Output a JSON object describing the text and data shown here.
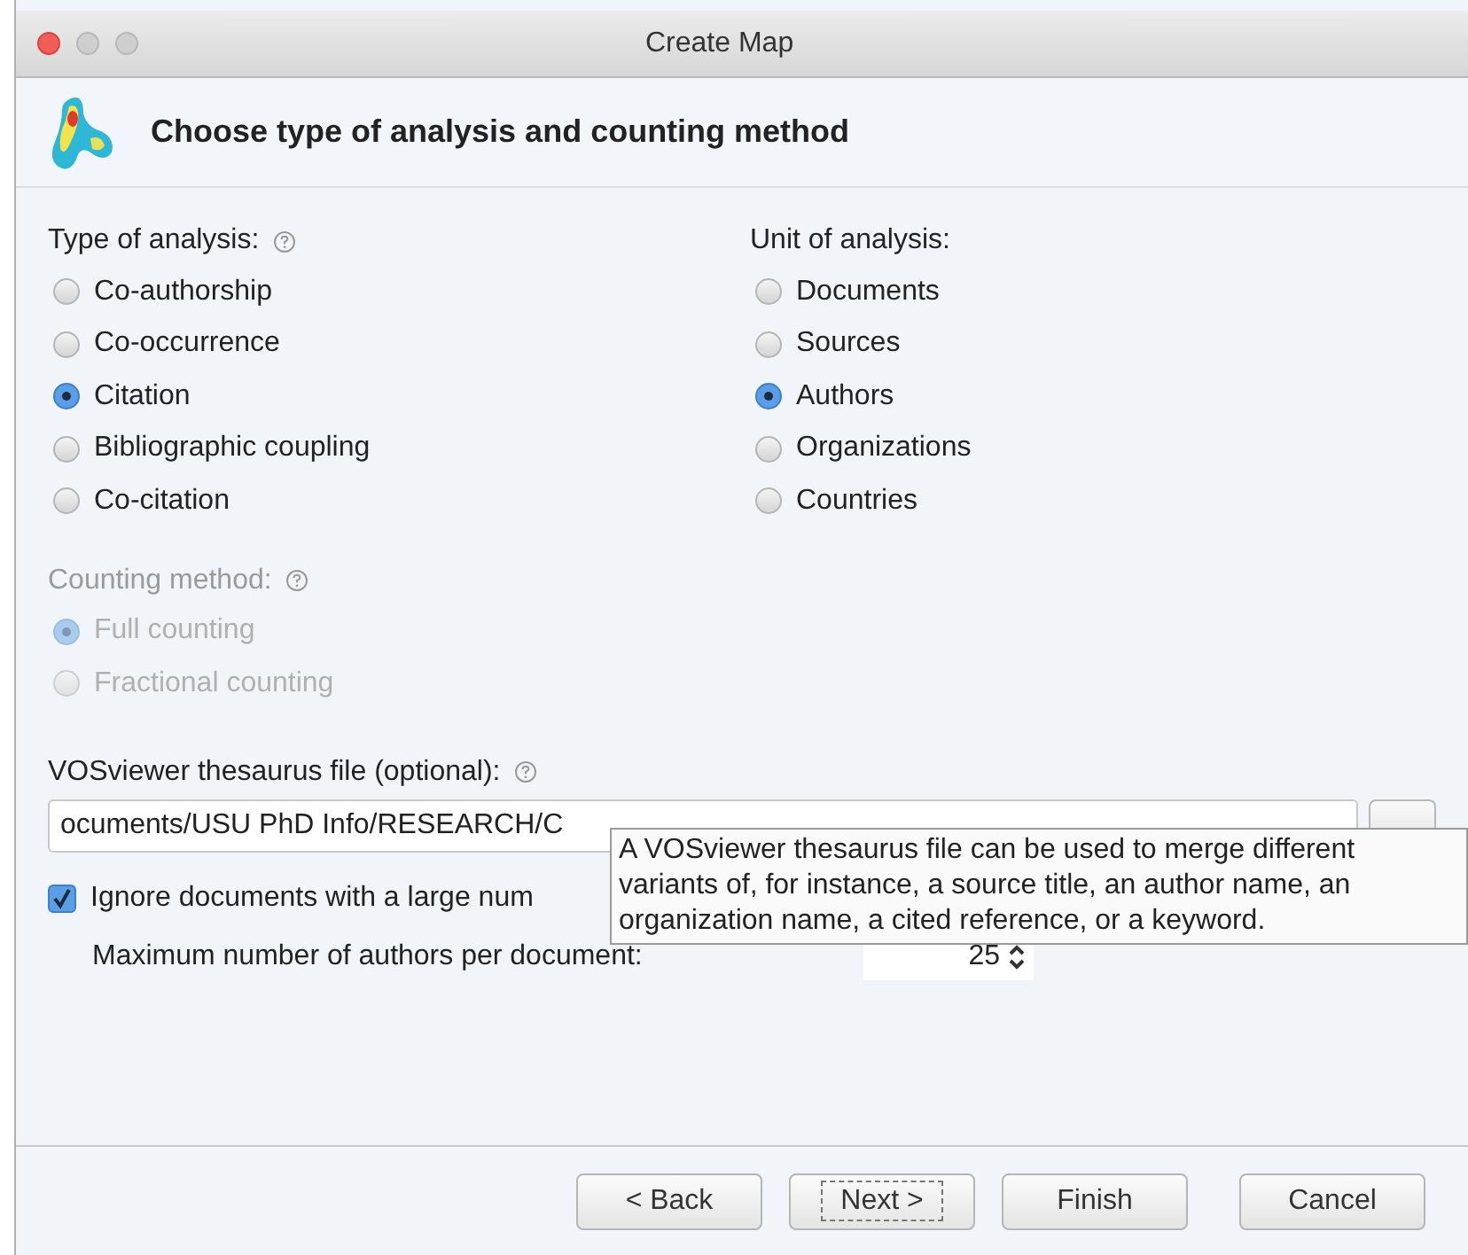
{
  "window": {
    "title": "Create Map"
  },
  "header": {
    "title": "Choose type of analysis and counting method"
  },
  "type_of_analysis": {
    "label": "Type of analysis:",
    "help_icon": true,
    "disabled": false,
    "options": [
      {
        "label": "Co-authorship",
        "selected": false
      },
      {
        "label": "Co-occurrence",
        "selected": false
      },
      {
        "label": "Citation",
        "selected": true
      },
      {
        "label": "Bibliographic coupling",
        "selected": false
      },
      {
        "label": "Co-citation",
        "selected": false
      }
    ]
  },
  "unit_of_analysis": {
    "label": "Unit of analysis:",
    "help_icon": false,
    "disabled": false,
    "options": [
      {
        "label": "Documents",
        "selected": false
      },
      {
        "label": "Sources",
        "selected": false
      },
      {
        "label": "Authors",
        "selected": true
      },
      {
        "label": "Organizations",
        "selected": false
      },
      {
        "label": "Countries",
        "selected": false
      }
    ]
  },
  "counting_method": {
    "label": "Counting method:",
    "help_icon": true,
    "disabled": true,
    "options": [
      {
        "label": "Full counting",
        "selected": true
      },
      {
        "label": "Fractional counting",
        "selected": false
      }
    ]
  },
  "thesaurus": {
    "label": "VOSviewer thesaurus file (optional):",
    "value": "ocuments/USU PhD Info/RESEARCH/C"
  },
  "ignore_checkbox": {
    "label": "Ignore documents with a large num",
    "checked": true
  },
  "max_authors": {
    "label": "Maximum number of authors per document:",
    "value": "25"
  },
  "tooltip": {
    "text": "A VOSviewer thesaurus file can be used to merge different variants of, for instance, a source title, an author name, an organization name, a cited reference, or a keyword."
  },
  "buttons": [
    {
      "label": "< Back",
      "focused": false
    },
    {
      "label": "Next >",
      "focused": true
    },
    {
      "label": "Finish",
      "focused": false
    },
    {
      "label": "Cancel",
      "focused": false
    }
  ]
}
